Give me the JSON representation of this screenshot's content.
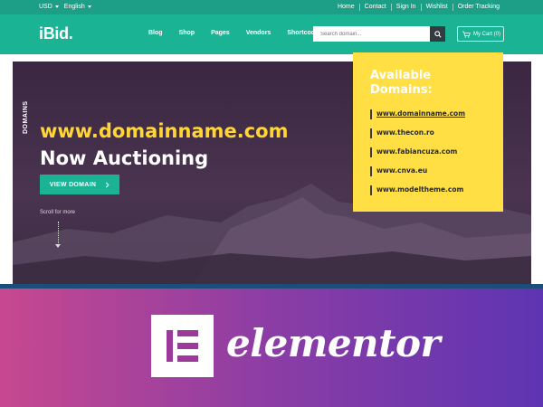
{
  "topbar": {
    "currency": "USD",
    "language": "English",
    "links": [
      "Home",
      "Contact",
      "Sign In",
      "Wishlist",
      "Order Tracking"
    ]
  },
  "header": {
    "logo": "iBid.",
    "nav": [
      "Blog",
      "Shop",
      "Pages",
      "Vendors",
      "Shortcodes"
    ],
    "search_placeholder": "Search domain...",
    "cart_label": "My Cart (0)"
  },
  "hero": {
    "side_label": "DOMAINS",
    "title_line1": "www.domainname.com",
    "title_line2": "Now Auctioning",
    "button_label": "VIEW DOMAIN",
    "scroll_label": "Scroll for more"
  },
  "domains_card": {
    "title": "Available Domains:",
    "items": [
      "www.domainname.com",
      "www.thecon.ro",
      "www.fabiancuza.com",
      "www.cnva.eu",
      "www.modeltheme.com"
    ]
  },
  "banner": {
    "wordmark": "elementor"
  },
  "colors": {
    "topbar": "#1d9f87",
    "header": "#1ab394",
    "accent_yellow": "#ffdf44",
    "hero_bg": "#3f2a45"
  }
}
